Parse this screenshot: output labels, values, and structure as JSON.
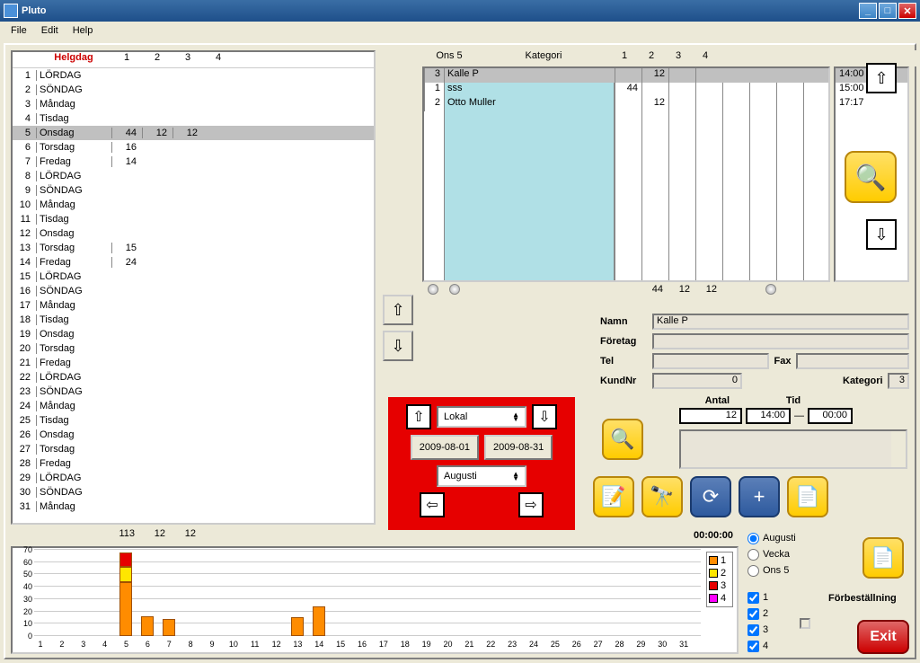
{
  "window": {
    "title": "Pluto"
  },
  "menu": {
    "file": "File",
    "edit": "Edit",
    "help": "Help"
  },
  "calendar": {
    "header_day": "Helgdag",
    "cols": [
      "1",
      "2",
      "3",
      "4"
    ],
    "rows": [
      {
        "i": 1,
        "d": "LÖRDAG",
        "v": [
          "",
          "",
          "",
          ""
        ]
      },
      {
        "i": 2,
        "d": "SÖNDAG",
        "v": [
          "",
          "",
          "",
          ""
        ]
      },
      {
        "i": 3,
        "d": "Måndag",
        "v": [
          "",
          "",
          "",
          ""
        ]
      },
      {
        "i": 4,
        "d": "Tisdag",
        "v": [
          "",
          "",
          "",
          ""
        ]
      },
      {
        "i": 5,
        "d": "Onsdag",
        "v": [
          "44",
          "12",
          "12",
          ""
        ],
        "sel": true
      },
      {
        "i": 6,
        "d": "Torsdag",
        "v": [
          "16",
          "",
          "",
          ""
        ]
      },
      {
        "i": 7,
        "d": "Fredag",
        "v": [
          "14",
          "",
          "",
          ""
        ]
      },
      {
        "i": 8,
        "d": "LÖRDAG",
        "v": [
          "",
          "",
          "",
          ""
        ]
      },
      {
        "i": 9,
        "d": "SÖNDAG",
        "v": [
          "",
          "",
          "",
          ""
        ]
      },
      {
        "i": 10,
        "d": "Måndag",
        "v": [
          "",
          "",
          "",
          ""
        ]
      },
      {
        "i": 11,
        "d": "Tisdag",
        "v": [
          "",
          "",
          "",
          ""
        ]
      },
      {
        "i": 12,
        "d": "Onsdag",
        "v": [
          "",
          "",
          "",
          ""
        ]
      },
      {
        "i": 13,
        "d": "Torsdag",
        "v": [
          "15",
          "",
          "",
          ""
        ]
      },
      {
        "i": 14,
        "d": "Fredag",
        "v": [
          "24",
          "",
          "",
          ""
        ]
      },
      {
        "i": 15,
        "d": "LÖRDAG",
        "v": [
          "",
          "",
          "",
          ""
        ]
      },
      {
        "i": 16,
        "d": "SÖNDAG",
        "v": [
          "",
          "",
          "",
          ""
        ]
      },
      {
        "i": 17,
        "d": "Måndag",
        "v": [
          "",
          "",
          "",
          ""
        ]
      },
      {
        "i": 18,
        "d": "Tisdag",
        "v": [
          "",
          "",
          "",
          ""
        ]
      },
      {
        "i": 19,
        "d": "Onsdag",
        "v": [
          "",
          "",
          "",
          ""
        ]
      },
      {
        "i": 20,
        "d": "Torsdag",
        "v": [
          "",
          "",
          "",
          ""
        ]
      },
      {
        "i": 21,
        "d": "Fredag",
        "v": [
          "",
          "",
          "",
          ""
        ]
      },
      {
        "i": 22,
        "d": "LÖRDAG",
        "v": [
          "",
          "",
          "",
          ""
        ]
      },
      {
        "i": 23,
        "d": "SÖNDAG",
        "v": [
          "",
          "",
          "",
          ""
        ]
      },
      {
        "i": 24,
        "d": "Måndag",
        "v": [
          "",
          "",
          "",
          ""
        ]
      },
      {
        "i": 25,
        "d": "Tisdag",
        "v": [
          "",
          "",
          "",
          ""
        ]
      },
      {
        "i": 26,
        "d": "Onsdag",
        "v": [
          "",
          "",
          "",
          ""
        ]
      },
      {
        "i": 27,
        "d": "Torsdag",
        "v": [
          "",
          "",
          "",
          ""
        ]
      },
      {
        "i": 28,
        "d": "Fredag",
        "v": [
          "",
          "",
          "",
          ""
        ]
      },
      {
        "i": 29,
        "d": "LÖRDAG",
        "v": [
          "",
          "",
          "",
          ""
        ]
      },
      {
        "i": 30,
        "d": "SÖNDAG",
        "v": [
          "",
          "",
          "",
          ""
        ]
      },
      {
        "i": 31,
        "d": "Måndag",
        "v": [
          "",
          "",
          "",
          ""
        ]
      }
    ],
    "totals": [
      "113",
      "12",
      "12",
      ""
    ]
  },
  "detail": {
    "day_label": "Ons 5",
    "kategori_label": "Kategori",
    "cols": [
      "1",
      "2",
      "3",
      "4"
    ],
    "rows": [
      {
        "i": 3,
        "name": "Kalle P",
        "v": [
          "",
          "12",
          "",
          ""
        ],
        "t": "14:00",
        "sel": true
      },
      {
        "i": 1,
        "name": "sss",
        "v": [
          "44",
          "",
          "",
          ""
        ],
        "t": "15:00"
      },
      {
        "i": 2,
        "name": "Otto Muller",
        "v": [
          "",
          "12",
          "",
          ""
        ],
        "t": "17:17"
      }
    ],
    "totals": [
      "44",
      "12",
      "12",
      ""
    ]
  },
  "form": {
    "namn_label": "Namn",
    "namn": "Kalle P",
    "foretag_label": "Företag",
    "foretag": "",
    "tel_label": "Tel",
    "tel": "",
    "fax_label": "Fax",
    "fax": "",
    "kundnr_label": "KundNr",
    "kundnr": "0",
    "kategori_label": "Kategori",
    "kategori": "3"
  },
  "red_panel": {
    "lokal": "Lokal",
    "date_from": "2009-08-01",
    "date_to": "2009-08-31",
    "month": "Augusti"
  },
  "antaltid": {
    "antal_label": "Antal",
    "antal": "12",
    "tid_label": "Tid",
    "tid_from": "14:00",
    "dash": "—",
    "tid_to": "00:00"
  },
  "timer": "00:00:00",
  "radios": {
    "r1": "Augusti",
    "r2": "Vecka",
    "r3": "Ons 5",
    "selected": 0
  },
  "checks": {
    "c1": "1",
    "c2": "2",
    "c3": "3",
    "c4": "4"
  },
  "chart_data": {
    "type": "bar",
    "ylim": [
      0,
      70
    ],
    "yticks": [
      0,
      10,
      20,
      30,
      40,
      50,
      60,
      70
    ],
    "categories": [
      1,
      2,
      3,
      4,
      5,
      6,
      7,
      8,
      9,
      10,
      11,
      12,
      13,
      14,
      15,
      16,
      17,
      18,
      19,
      20,
      21,
      22,
      23,
      24,
      25,
      26,
      27,
      28,
      29,
      30,
      31
    ],
    "series": [
      {
        "name": "1",
        "color": "#ff8c00",
        "values": [
          0,
          0,
          0,
          0,
          44,
          16,
          14,
          0,
          0,
          0,
          0,
          0,
          15,
          24,
          0,
          0,
          0,
          0,
          0,
          0,
          0,
          0,
          0,
          0,
          0,
          0,
          0,
          0,
          0,
          0,
          0
        ]
      },
      {
        "name": "2",
        "color": "#ffe600",
        "values": [
          0,
          0,
          0,
          0,
          12,
          0,
          0,
          0,
          0,
          0,
          0,
          0,
          0,
          0,
          0,
          0,
          0,
          0,
          0,
          0,
          0,
          0,
          0,
          0,
          0,
          0,
          0,
          0,
          0,
          0,
          0
        ]
      },
      {
        "name": "3",
        "color": "#e60000",
        "values": [
          0,
          0,
          0,
          0,
          12,
          0,
          0,
          0,
          0,
          0,
          0,
          0,
          0,
          0,
          0,
          0,
          0,
          0,
          0,
          0,
          0,
          0,
          0,
          0,
          0,
          0,
          0,
          0,
          0,
          0,
          0
        ]
      },
      {
        "name": "4",
        "color": "#ff00ff",
        "values": [
          0,
          0,
          0,
          0,
          0,
          0,
          0,
          0,
          0,
          0,
          0,
          0,
          0,
          0,
          0,
          0,
          0,
          0,
          0,
          0,
          0,
          0,
          0,
          0,
          0,
          0,
          0,
          0,
          0,
          0,
          0
        ]
      }
    ]
  },
  "forbestallning": "Förbeställning",
  "exit": "Exit"
}
